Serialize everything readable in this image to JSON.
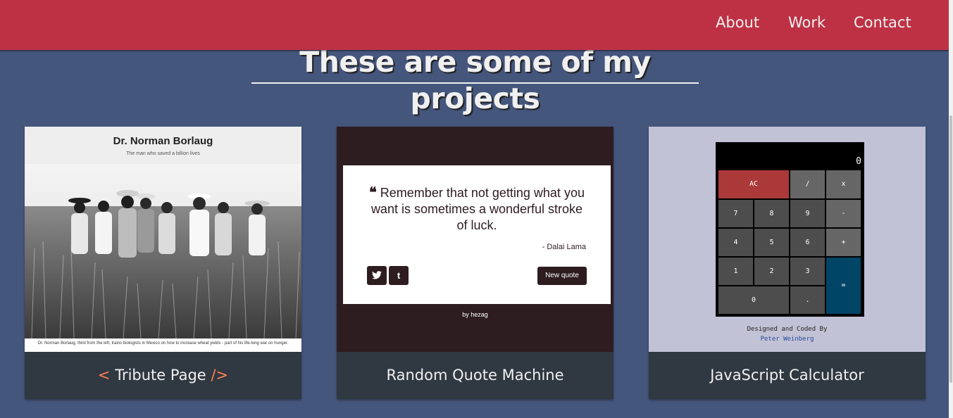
{
  "nav": {
    "links": [
      "About",
      "Work",
      "Contact"
    ]
  },
  "title": "These are some of my projects",
  "projects": [
    {
      "label_open": "<",
      "label": "Tribute Page",
      "label_close": "/>",
      "preview": {
        "heading": "Dr. Norman Borlaug",
        "subheading": "The man who saved a billion lives",
        "caption": "Dr. Norman Borlaug, third from the left, trains biologists in Mexico on how to increase wheat yields - part of his life-long war on hunger."
      }
    },
    {
      "label": "Random Quote Machine",
      "preview": {
        "quote": "Remember that not getting what you want is sometimes a wonderful stroke of luck.",
        "author": "- Dalai Lama",
        "tweet_icon": "twitter-icon",
        "tumblr_icon": "tumblr-icon",
        "button": "New quote",
        "footer": "by hezag"
      }
    },
    {
      "label": "JavaScript Calculator",
      "preview": {
        "display": "0",
        "keys": [
          "AC",
          "/",
          "x",
          "7",
          "8",
          "9",
          "-",
          "4",
          "5",
          "6",
          "+",
          "1",
          "2",
          "3",
          "=",
          "0",
          "."
        ],
        "credit_line1": "Designed and Coded By",
        "credit_line2": "Peter Weinberg"
      }
    }
  ],
  "colors": {
    "navbar": "#be3144",
    "background": "#45567d",
    "card_label": "#303841",
    "bracket": "#ff7f50"
  }
}
